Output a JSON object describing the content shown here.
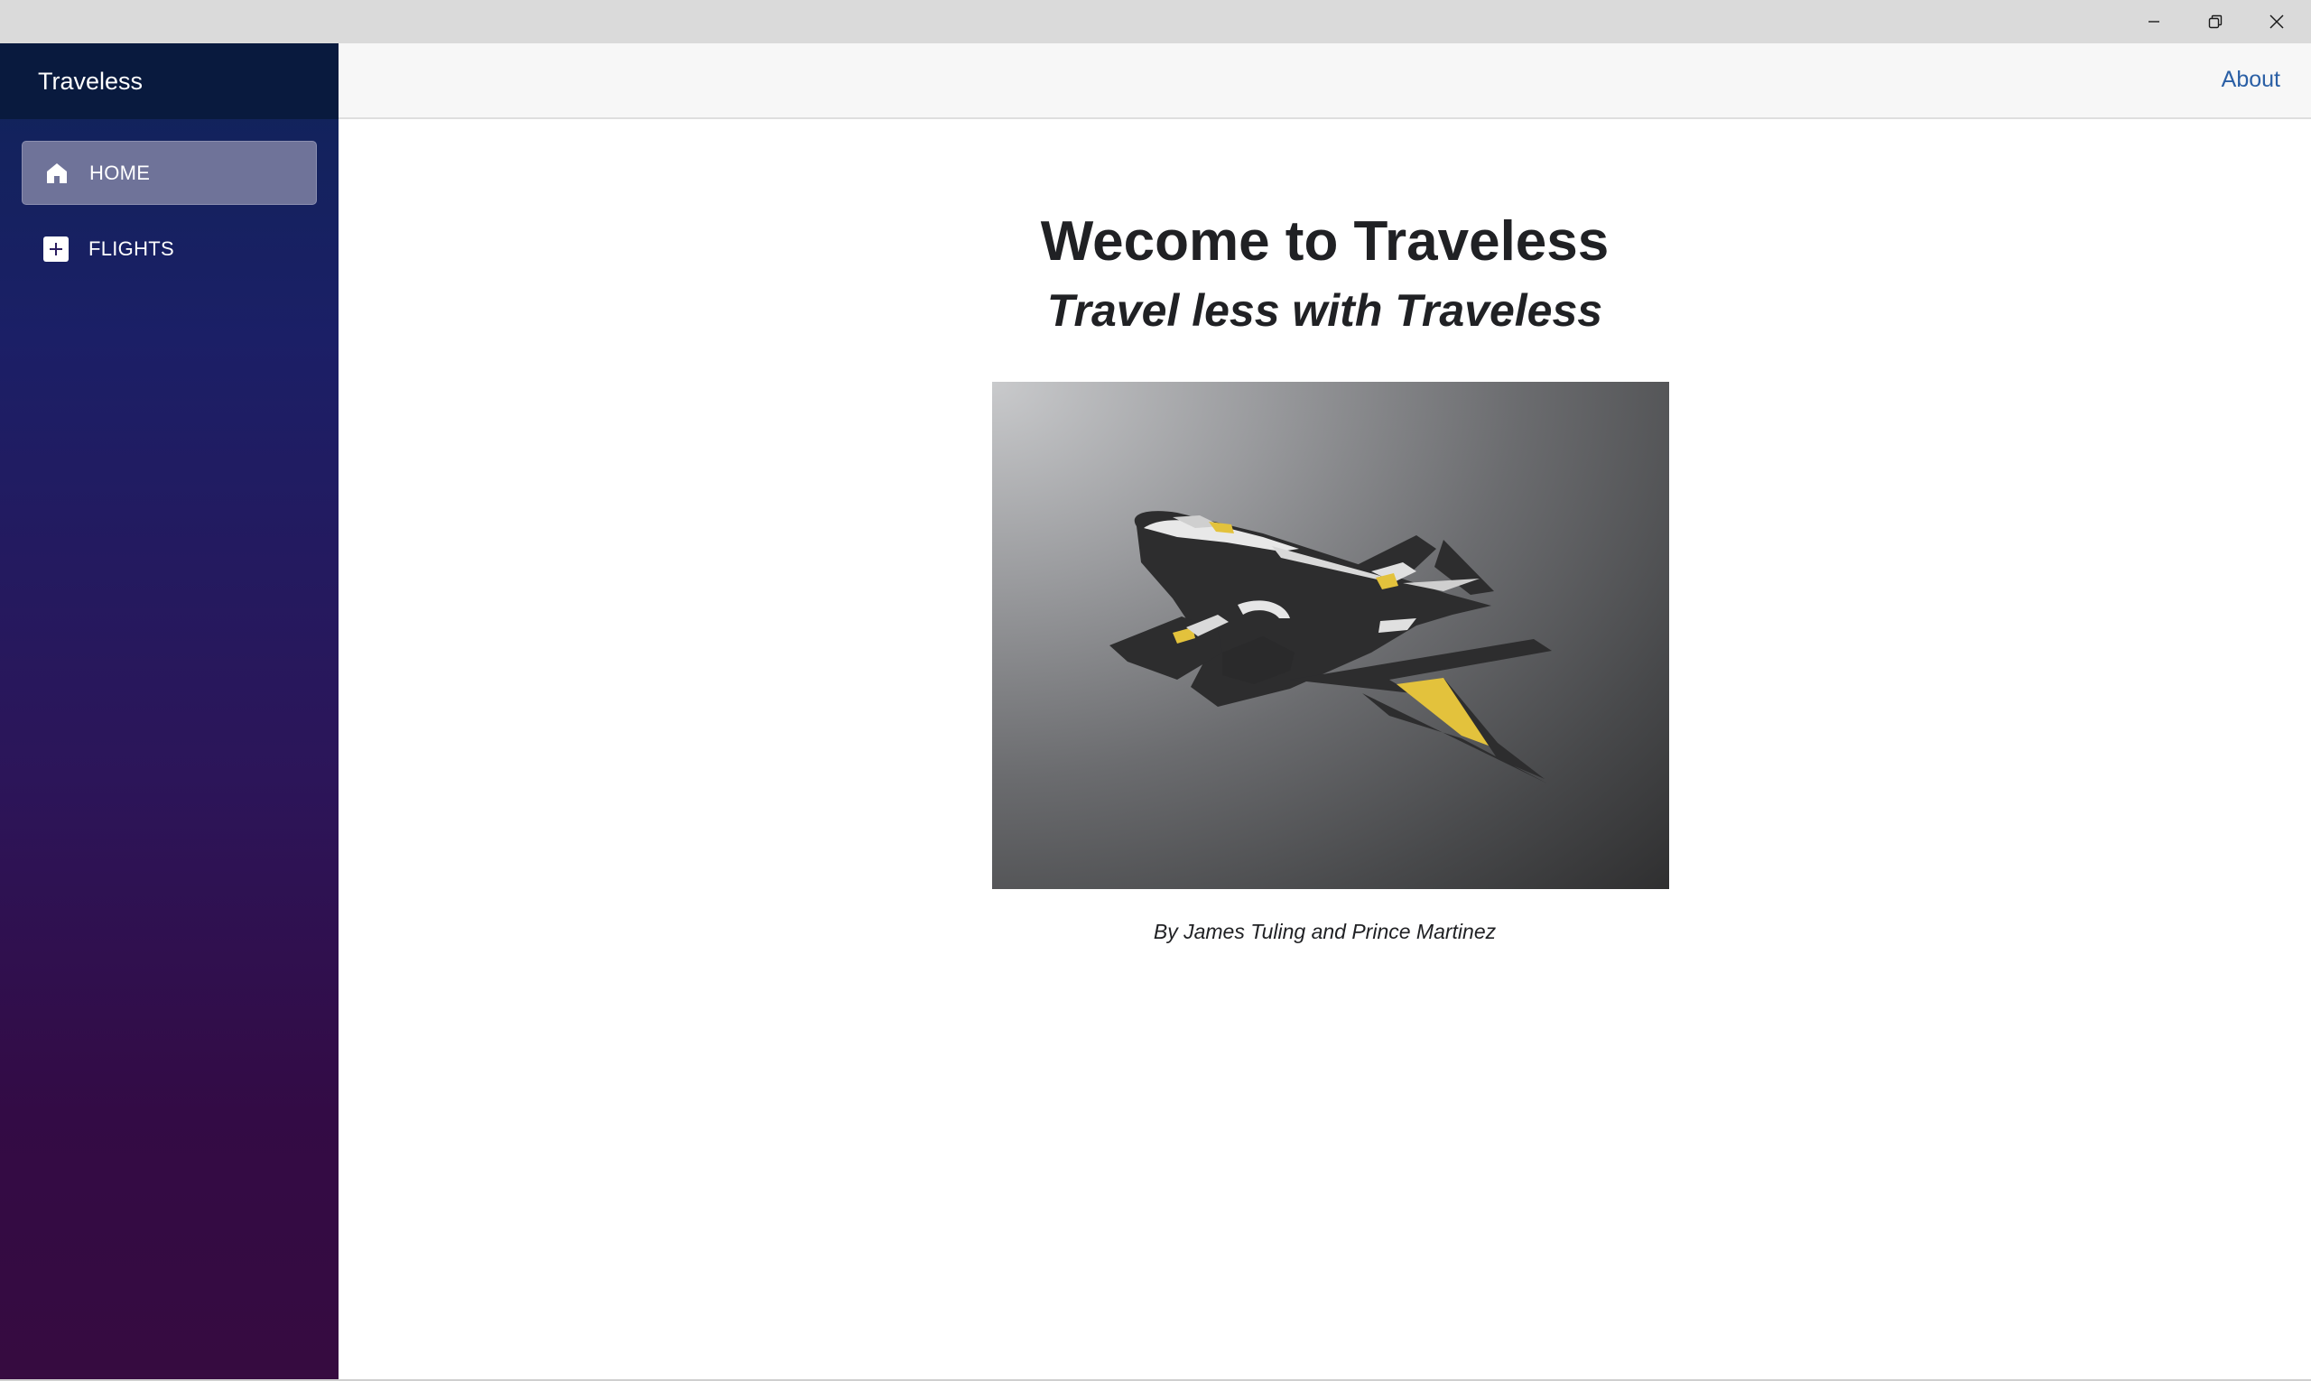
{
  "window": {
    "controls": {
      "minimize_icon": "minimize-icon",
      "maximize_icon": "restore-icon",
      "close_icon": "close-icon"
    }
  },
  "sidebar": {
    "brand": "Traveless",
    "items": [
      {
        "label": "HOME",
        "icon": "home-icon",
        "active": true
      },
      {
        "label": "FLIGHTS",
        "icon": "plus-square-icon",
        "active": false
      }
    ]
  },
  "topbar": {
    "about_label": "About"
  },
  "main": {
    "title": "Wecome to Traveless",
    "subtitle": "Travel less with Traveless",
    "credits": "By James Tuling and Prince Martinez",
    "hero_image": "jet-airplane-logo"
  },
  "colors": {
    "sidebar_header": "#091a3e",
    "sidebar_top": "#0f2459",
    "sidebar_bottom": "#360b40",
    "active_item": "#6f7399",
    "link": "#2a5fa5",
    "text": "#202124",
    "accent_yellow": "#e3c23c"
  }
}
